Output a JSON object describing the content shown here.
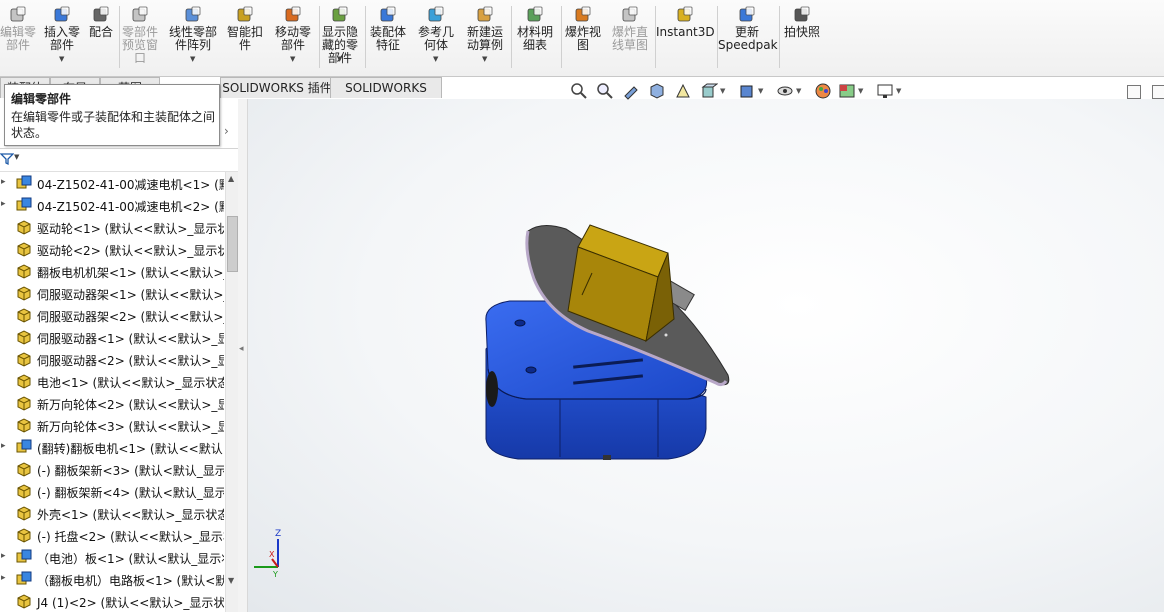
{
  "ribbon": {
    "buttons": [
      {
        "label": "编辑零\n部件",
        "icon": "edit-component-icon",
        "disabled": true
      },
      {
        "label": "插入零\n部件",
        "icon": "insert-component-icon",
        "disabled": false
      },
      {
        "label": "配合",
        "icon": "mate-icon",
        "disabled": false
      },
      {
        "label": "零部件\n预览窗\n口",
        "icon": "component-preview-icon",
        "disabled": true
      },
      {
        "label": "线性零部\n件阵列",
        "icon": "linear-pattern-icon",
        "disabled": false
      },
      {
        "label": "智能扣\n件",
        "icon": "smart-fasteners-icon",
        "disabled": false
      },
      {
        "label": "移动零\n部件",
        "icon": "move-component-icon",
        "disabled": false
      },
      {
        "label": "显示隐\n藏的零\n部件",
        "icon": "show-hidden-icon",
        "disabled": false
      },
      {
        "label": "装配体\n特征",
        "icon": "assembly-features-icon",
        "disabled": false
      },
      {
        "label": "参考几\n何体",
        "icon": "reference-geometry-icon",
        "disabled": false
      },
      {
        "label": "新建运\n动算例",
        "icon": "new-motion-study-icon",
        "disabled": false
      },
      {
        "label": "材料明\n细表",
        "icon": "bill-of-materials-icon",
        "disabled": false
      },
      {
        "label": "爆炸视\n图",
        "icon": "exploded-view-icon",
        "disabled": false
      },
      {
        "label": "爆炸直\n线草图",
        "icon": "explode-line-sketch-icon",
        "disabled": true
      },
      {
        "label": "Instant3D",
        "icon": "instant3d-icon",
        "disabled": false
      },
      {
        "label": "更新\nSpeedpak",
        "icon": "speedpak-icon",
        "disabled": false
      },
      {
        "label": "拍快照",
        "icon": "camera-icon",
        "disabled": false
      }
    ]
  },
  "tabs": [
    {
      "label": "装配体"
    },
    {
      "label": "布局"
    },
    {
      "label": "草图"
    },
    {
      "label": "SOLIDWORKS 插件"
    },
    {
      "label": "SOLIDWORKS MBD"
    }
  ],
  "tooltip": {
    "title": "编辑零部件",
    "body": "在编辑零件或子装配体和主装配体之间状态。"
  },
  "tree": {
    "items": [
      {
        "label": "04-Z1502-41-00减速电机<1> (默",
        "icon": "subassembly-icon"
      },
      {
        "label": "04-Z1502-41-00减速电机<2> (默",
        "icon": "subassembly-icon"
      },
      {
        "label": "驱动轮<1> (默认<<默认>_显示状",
        "icon": "part-icon"
      },
      {
        "label": "驱动轮<2> (默认<<默认>_显示状",
        "icon": "part-icon"
      },
      {
        "label": "翻板电机机架<1> (默认<<默认>_",
        "icon": "part-icon"
      },
      {
        "label": "伺服驱动器架<1> (默认<<默认>_",
        "icon": "part-icon"
      },
      {
        "label": "伺服驱动器架<2> (默认<<默认>_",
        "icon": "part-icon"
      },
      {
        "label": "伺服驱动器<1> (默认<<默认>_显",
        "icon": "part-icon"
      },
      {
        "label": "伺服驱动器<2> (默认<<默认>_显",
        "icon": "part-icon"
      },
      {
        "label": "电池<1> (默认<<默认>_显示状态",
        "icon": "part-icon"
      },
      {
        "label": "新万向轮体<2> (默认<<默认>_显",
        "icon": "part-icon"
      },
      {
        "label": "新万向轮体<3> (默认<<默认>_显",
        "icon": "part-icon"
      },
      {
        "label": "(翻转)翻板电机<1> (默认<<默认>",
        "icon": "subassembly-icon"
      },
      {
        "label": "(-) 翻板架新<3> (默认<默认_显示",
        "icon": "part-icon"
      },
      {
        "label": "(-) 翻板架新<4> (默认<默认_显示",
        "icon": "part-icon"
      },
      {
        "label": "外壳<1> (默认<<默认>_显示状态",
        "icon": "part-icon"
      },
      {
        "label": "(-) 托盘<2> (默认<<默认>_显示状",
        "icon": "part-icon"
      },
      {
        "label": "（电池）板<1> (默认<默认_显示状",
        "icon": "subassembly-icon"
      },
      {
        "label": "（翻板电机）电路板<1> (默认<默",
        "icon": "subassembly-icon"
      },
      {
        "label": "J4 (1)<2> (默认<<默认>_显示状态",
        "icon": "part-icon"
      }
    ]
  },
  "colors": {
    "base_blue": "#1f4fd6",
    "box_gold": "#a8860a",
    "plate_gray": "#5c5c5c",
    "tab_border": "#b8b8b8"
  },
  "axes": {
    "z": "Z",
    "x": "X",
    "y": "Y"
  }
}
